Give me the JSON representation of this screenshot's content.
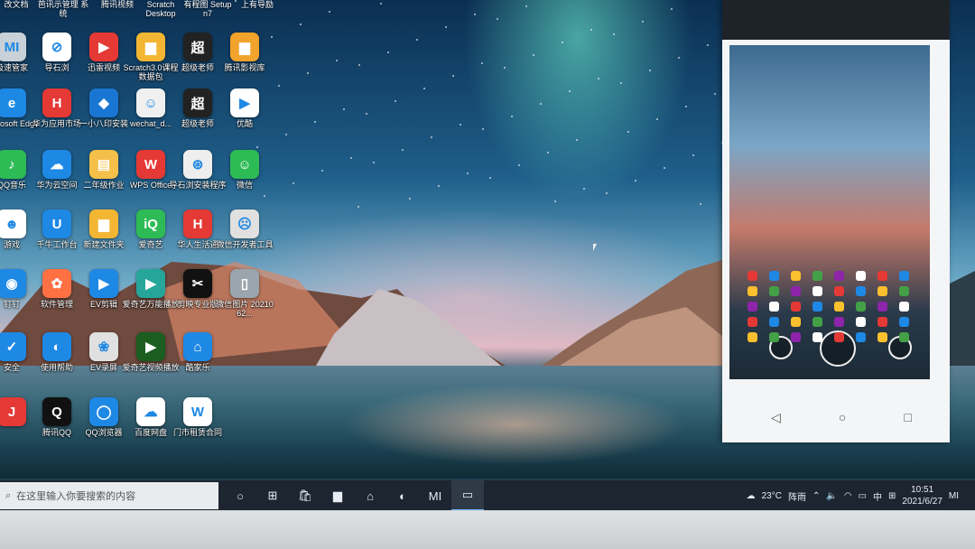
{
  "desktop": {
    "top_labels": [
      "改文档",
      "芭讯示管理 系统",
      "腾讯视频",
      "Scratch Desktop",
      "有程图 Setup n7",
      "上有导励"
    ],
    "icons": [
      {
        "label": "极速管家",
        "icon": "mi-icon",
        "color": "#c8d0d8",
        "glyph": "MI"
      },
      {
        "label": "导石浏",
        "icon": "browser-icon",
        "color": "#ffffff",
        "glyph": "⊘"
      },
      {
        "label": "迅雷视频",
        "icon": "play-icon",
        "color": "#e53935",
        "glyph": "▶"
      },
      {
        "label": "Scratch3.0课程数据包",
        "icon": "folder-icon",
        "color": "#f2b632",
        "glyph": "▆"
      },
      {
        "label": "超级老师",
        "icon": "teacher-icon",
        "color": "#222222",
        "glyph": "超"
      },
      {
        "label": "腾讯影视库",
        "icon": "folder-icon",
        "color": "#f2a32c",
        "glyph": "▆"
      },
      {
        "label": "Microsoft Edge",
        "icon": "edge-icon",
        "color": "#1e88e5",
        "glyph": "e"
      },
      {
        "label": "华为应用市场",
        "icon": "huawei-icon",
        "color": "#e53935",
        "glyph": "H"
      },
      {
        "label": "一小八印安装",
        "icon": "install-icon",
        "color": "#1976d2",
        "glyph": "◆"
      },
      {
        "label": "wechat_d...",
        "icon": "wechat-icon",
        "color": "#f0f0f0",
        "glyph": "☺"
      },
      {
        "label": "超级老师",
        "icon": "teacher-icon",
        "color": "#222222",
        "glyph": "超"
      },
      {
        "label": "优酷",
        "icon": "youku-icon",
        "color": "#ffffff",
        "glyph": "▶"
      },
      {
        "label": "QQ音乐",
        "icon": "music-icon",
        "color": "#2dbb55",
        "glyph": "♪"
      },
      {
        "label": "华为云空间",
        "icon": "cloud-icon",
        "color": "#1e88e5",
        "glyph": "☁"
      },
      {
        "label": "二年级作业",
        "icon": "file-icon",
        "color": "#f4c04a",
        "glyph": "▤"
      },
      {
        "label": "WPS Office",
        "icon": "wps-icon",
        "color": "#e53935",
        "glyph": "W"
      },
      {
        "label": "导石浏安装程序",
        "icon": "setup-icon",
        "color": "#eeeeee",
        "glyph": "⊛"
      },
      {
        "label": "微信",
        "icon": "wechat-icon",
        "color": "#2dbb55",
        "glyph": "☺"
      },
      {
        "label": "游戏",
        "icon": "game-icon",
        "color": "#ffffff",
        "glyph": "☻"
      },
      {
        "label": "千牛工作台",
        "icon": "qianniu-icon",
        "color": "#1e88e5",
        "glyph": "U"
      },
      {
        "label": "新建文件夹",
        "icon": "folder-icon",
        "color": "#f2b632",
        "glyph": "▆"
      },
      {
        "label": "爱奇艺",
        "icon": "iqiyi-icon",
        "color": "#2dbb55",
        "glyph": "iQ"
      },
      {
        "label": "华人生活通",
        "icon": "life-icon",
        "color": "#e53935",
        "glyph": "H"
      },
      {
        "label": "微信开发者工具",
        "icon": "devtool-icon",
        "color": "#e0e0e0",
        "glyph": "☹"
      },
      {
        "label": "钉钉",
        "icon": "app-icon",
        "color": "#1e88e5",
        "glyph": "◉"
      },
      {
        "label": "软件管理",
        "icon": "apps-icon",
        "color": "#ff7043",
        "glyph": "✿"
      },
      {
        "label": "EV剪辑",
        "icon": "ev-icon",
        "color": "#1e88e5",
        "glyph": "▶"
      },
      {
        "label": "爱奇艺万能播放",
        "icon": "player-icon",
        "color": "#26a69a",
        "glyph": "▶"
      },
      {
        "label": "剪映专业版",
        "icon": "capcut-icon",
        "color": "#111111",
        "glyph": "✂"
      },
      {
        "label": "微信图片 2021062...",
        "icon": "image-icon",
        "color": "#9aa5ad",
        "glyph": "▯"
      },
      {
        "label": "安全",
        "icon": "shield-icon",
        "color": "#1e88e5",
        "glyph": "✓"
      },
      {
        "label": "使用帮助",
        "icon": "help-icon",
        "color": "#1e88e5",
        "glyph": "◐"
      },
      {
        "label": "EV录屏",
        "icon": "record-icon",
        "color": "#e0e0e0",
        "glyph": "❀"
      },
      {
        "label": "爱奇艺视频播放",
        "icon": "player-icon",
        "color": "#1b5e20",
        "glyph": "▶"
      },
      {
        "label": "酷家乐",
        "icon": "kujiale-icon",
        "color": "#1e88e5",
        "glyph": "⌂"
      },
      {
        "label": "",
        "icon": "app-icon",
        "color": "#e53935",
        "glyph": "J"
      },
      {
        "label": "腾讯QQ",
        "icon": "qq-icon",
        "color": "#111111",
        "glyph": "Q"
      },
      {
        "label": "QQ浏览器",
        "icon": "qq-browser-icon",
        "color": "#1e88e5",
        "glyph": "◯"
      },
      {
        "label": "百度网盘",
        "icon": "baidu-pan-icon",
        "color": "#ffffff",
        "glyph": "☁"
      },
      {
        "label": "门市租赁合同",
        "icon": "word-doc-icon",
        "color": "#ffffff",
        "glyph": "W"
      }
    ]
  },
  "phone": {
    "nav": [
      "◁",
      "○",
      "□"
    ]
  },
  "taskbar": {
    "search_placeholder": "在这里输入你要搜索的内容",
    "apps": [
      {
        "name": "task-view-icon",
        "glyph": "○"
      },
      {
        "name": "taskview-icon",
        "glyph": "⊞"
      },
      {
        "name": "store-icon",
        "glyph": "🛍"
      },
      {
        "name": "file-explorer-icon",
        "glyph": "▆"
      },
      {
        "name": "kujiale-icon",
        "glyph": "⌂"
      },
      {
        "name": "edge-icon",
        "glyph": "◐"
      },
      {
        "name": "mi-icon",
        "glyph": "MI"
      },
      {
        "name": "screen-mirror-icon",
        "glyph": "▭"
      }
    ],
    "weather_temp": "23°C",
    "weather_text": "阵雨",
    "ime": "中",
    "time": "10:51",
    "date": "2021/6/27"
  }
}
